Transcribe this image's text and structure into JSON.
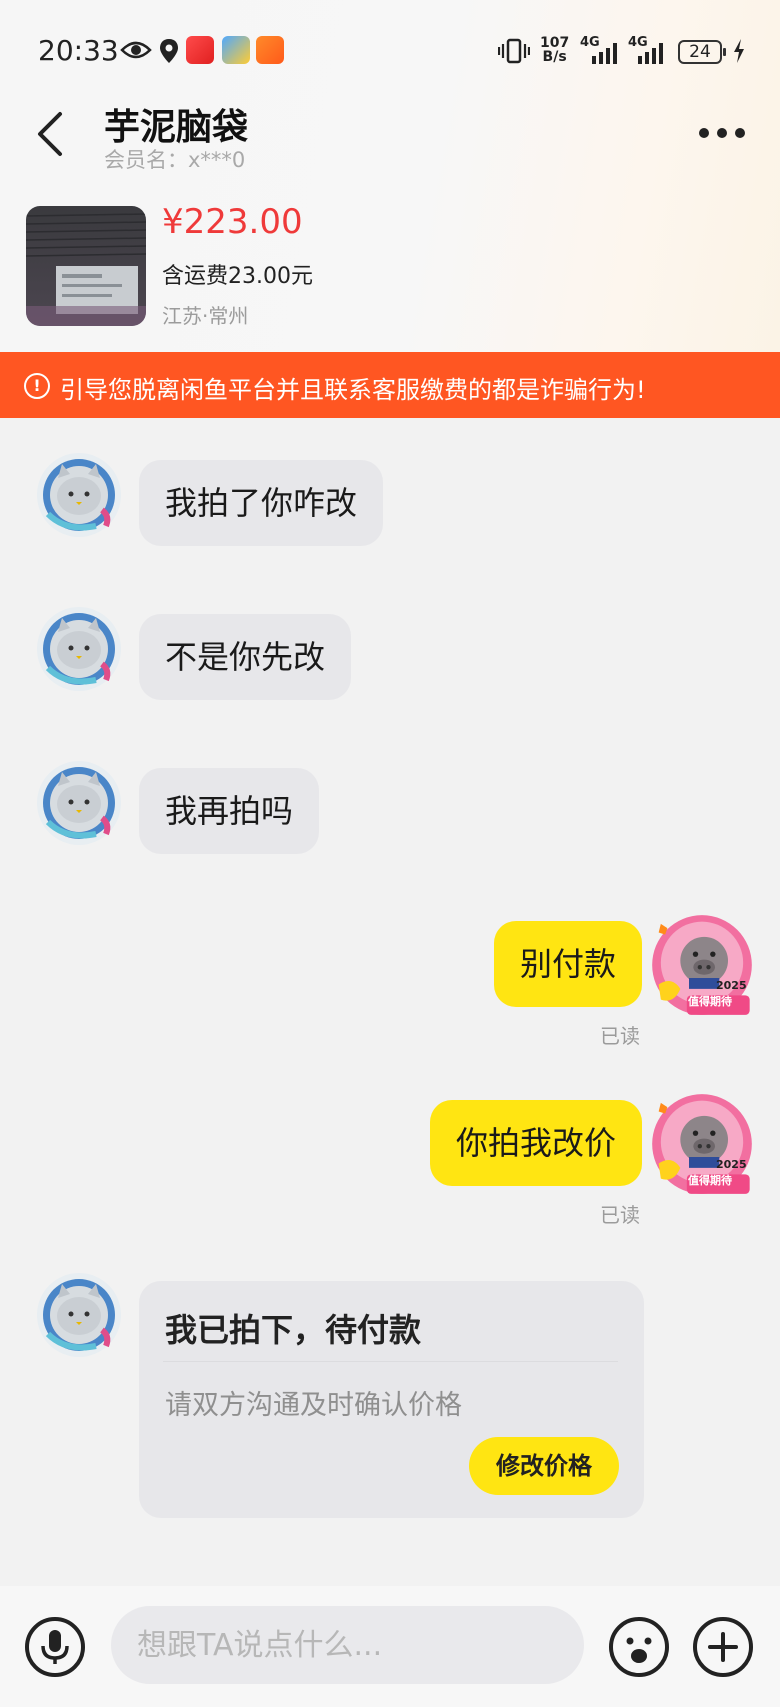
{
  "status_bar": {
    "time": "20:33",
    "net_speed_top": "107",
    "net_speed_bottom": "B/s",
    "signal1": "4G",
    "signal2": "4G",
    "battery": "24"
  },
  "header": {
    "nickname": "芋泥脑袋",
    "member_label": "会员名：x***0"
  },
  "product": {
    "price": "¥223.00",
    "shipping": "含运费23.00元",
    "location": "江苏·常州"
  },
  "warning": {
    "text": "引导您脱离闲鱼平台并且联系客服缴费的都是诈骗行为!"
  },
  "messages": [
    {
      "side": "left",
      "text": "我拍了你咋改"
    },
    {
      "side": "left",
      "text": "不是你先改"
    },
    {
      "side": "left",
      "text": "我再拍吗"
    },
    {
      "side": "right",
      "text": "别付款",
      "status": "已读"
    },
    {
      "side": "right",
      "text": "你拍我改价",
      "status": "已读"
    }
  ],
  "order_card": {
    "title": "我已拍下，待付款",
    "subtitle": "请双方沟通及时确认价格",
    "button": "修改价格"
  },
  "input_bar": {
    "placeholder": "想跟TA说点什么..."
  },
  "my_avatar_badge": "2025",
  "my_avatar_caption": "值得期待",
  "colors": {
    "accent_yellow": "#ffe512",
    "warning_orange": "#ff5622",
    "price_red": "#ef3a3a"
  }
}
